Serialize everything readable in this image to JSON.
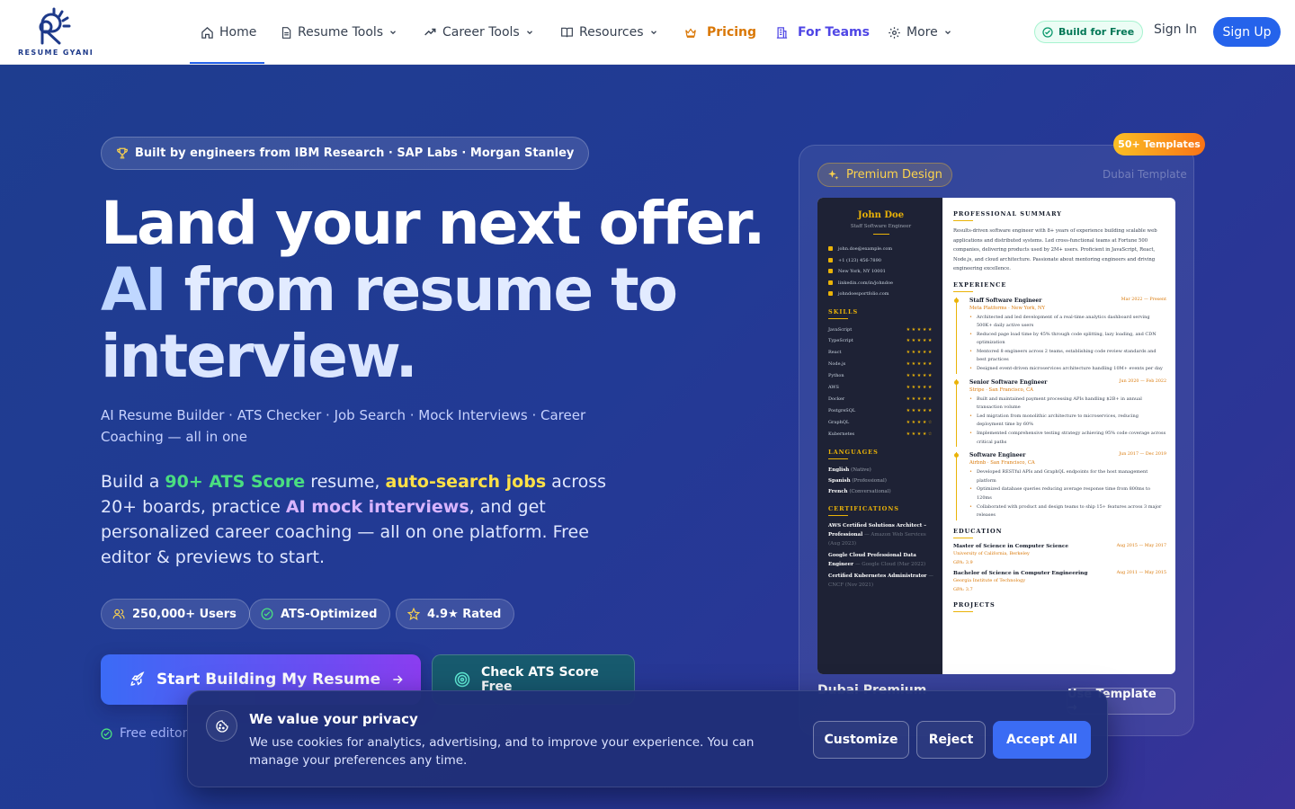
{
  "nav": {
    "brand": "RESUME GYANI",
    "items": [
      {
        "label": "Home",
        "icon": "home-icon"
      },
      {
        "label": "Resume Tools",
        "icon": "document-icon"
      },
      {
        "label": "Career Tools",
        "icon": "trending-up-icon"
      },
      {
        "label": "Resources",
        "icon": "book-open-icon"
      },
      {
        "label": "Pricing",
        "icon": "crown-icon"
      },
      {
        "label": "For Teams",
        "icon": "building-icon"
      },
      {
        "label": "More",
        "icon": "gear-icon"
      }
    ],
    "build_free": "Build for Free",
    "sign_in": "Sign In",
    "sign_up": "Sign Up"
  },
  "hero": {
    "badge": "Built by engineers from IBM Research · SAP Labs · Morgan Stanley",
    "headline_1": "Land your next offer.",
    "headline_2_ai": "AI",
    "headline_2_rest": "from resume to",
    "headline_3": "interview.",
    "subline": "AI Resume Builder · ATS Checker · Job Search · Mock Interviews · Career Coaching — all in one",
    "desc_1": "Build a ",
    "desc_green": "90+ ATS Score",
    "desc_2": " resume, ",
    "desc_yellow": "auto-search jobs",
    "desc_3": " across 20+ boards, practice ",
    "desc_purple": "AI mock interviews",
    "desc_4": ", and get personalized career coaching — all on one platform. Free editor & previews to start.",
    "pills": [
      "250,000+ Users",
      "ATS-Optimized",
      "4.9★ Rated"
    ],
    "cta_primary": "Start Building My Resume",
    "cta_secondary": "Check ATS Score Free",
    "free_note": "Free editor"
  },
  "card": {
    "templates_badge": "50+ Templates",
    "premium": "Premium Design",
    "template_name_small": "Dubai Template",
    "bottom_name": "Dubai Premium",
    "use_button": "Use Template →",
    "resume": {
      "name": "John Doe",
      "role": "Staff Software Engineer",
      "contacts": [
        "john.doe@example.com",
        "+1 (123) 456-7890",
        "New York, NY 10001",
        "linkedin.com/in/johndoe",
        "johndoesportfolio.com"
      ],
      "skills_title": "SKILLS",
      "skills": [
        {
          "name": "JavaScript",
          "stars": "★★★★★"
        },
        {
          "name": "TypeScript",
          "stars": "★★★★★"
        },
        {
          "name": "React",
          "stars": "★★★★★"
        },
        {
          "name": "Node.js",
          "stars": "★★★★★"
        },
        {
          "name": "Python",
          "stars": "★★★★★"
        },
        {
          "name": "AWS",
          "stars": "★★★★★"
        },
        {
          "name": "Docker",
          "stars": "★★★★★"
        },
        {
          "name": "PostgreSQL",
          "stars": "★★★★★"
        },
        {
          "name": "GraphQL",
          "stars": "★★★★☆"
        },
        {
          "name": "Kubernetes",
          "stars": "★★★★☆"
        }
      ],
      "languages_title": "LANGUAGES",
      "languages": [
        {
          "name": "English",
          "level": "(Native)"
        },
        {
          "name": "Spanish",
          "level": "(Professional)"
        },
        {
          "name": "French",
          "level": "(Conversational)"
        }
      ],
      "certs_title": "CERTIFICATIONS",
      "certs": [
        {
          "name": "AWS Certified Solutions Architect – Professional",
          "meta": "— Amazon Web Services (Aug 2023)"
        },
        {
          "name": "Google Cloud Professional Data Engineer",
          "meta": "— Google Cloud (Mar 2022)"
        },
        {
          "name": "Certified Kubernetes Administrator",
          "meta": "— CNCF (Nov 2021)"
        }
      ],
      "summary_title": "PROFESSIONAL SUMMARY",
      "summary": "Results-driven software engineer with 8+ years of experience building scalable web applications and distributed systems. Led cross-functional teams at Fortune 500 companies, delivering products used by 2M+ users. Proficient in JavaScript, React, Node.js, and cloud architecture. Passionate about mentoring engineers and driving engineering excellence.",
      "experience_title": "EXPERIENCE",
      "jobs": [
        {
          "title": "Staff Software Engineer",
          "dates": "Mar 2022 — Present",
          "company": "Meta Platforms · New York, NY",
          "bullets": [
            "Architected and led development of a real-time analytics dashboard serving 500K+ daily active users",
            "Reduced page load time by 45% through code splitting, lazy loading, and CDN optimization",
            "Mentored 8 engineers across 2 teams, establishing code review standards and best practices",
            "Designed event-driven microservices architecture handling 10M+ events per day"
          ]
        },
        {
          "title": "Senior Software Engineer",
          "dates": "Jun 2020 — Feb 2022",
          "company": "Stripe · San Francisco, CA",
          "bullets": [
            "Built and maintained payment processing APIs handling $2B+ in annual transaction volume",
            "Led migration from monolithic architecture to microservices, reducing deployment time by 60%",
            "Implemented comprehensive testing strategy achieving 95% code coverage across critical paths"
          ]
        },
        {
          "title": "Software Engineer",
          "dates": "Jun 2017 — Dec 2019",
          "company": "Airbnb · San Francisco, CA",
          "bullets": [
            "Developed RESTful APIs and GraphQL endpoints for the host management platform",
            "Optimized database queries reducing average response time from 800ms to 120ms",
            "Collaborated with product and design teams to ship 15+ features across 3 major releases"
          ]
        }
      ],
      "education_title": "EDUCATION",
      "education": [
        {
          "degree": "Master of Science in Computer Science",
          "dates": "Aug 2015 — May 2017",
          "school": "University of California, Berkeley",
          "gpa": "GPA: 3.9"
        },
        {
          "degree": "Bachelor of Science in Computer Engineering",
          "dates": "Aug 2011 — May 2015",
          "school": "Georgia Institute of Technology",
          "gpa": "GPA: 3.7"
        }
      ],
      "projects_title": "PROJECTS"
    }
  },
  "cookie": {
    "title": "We value your privacy",
    "text": "We use cookies for analytics, advertising, and to improve your experience. You can manage your preferences any time.",
    "customize": "Customize",
    "reject": "Reject",
    "accept": "Accept All"
  }
}
